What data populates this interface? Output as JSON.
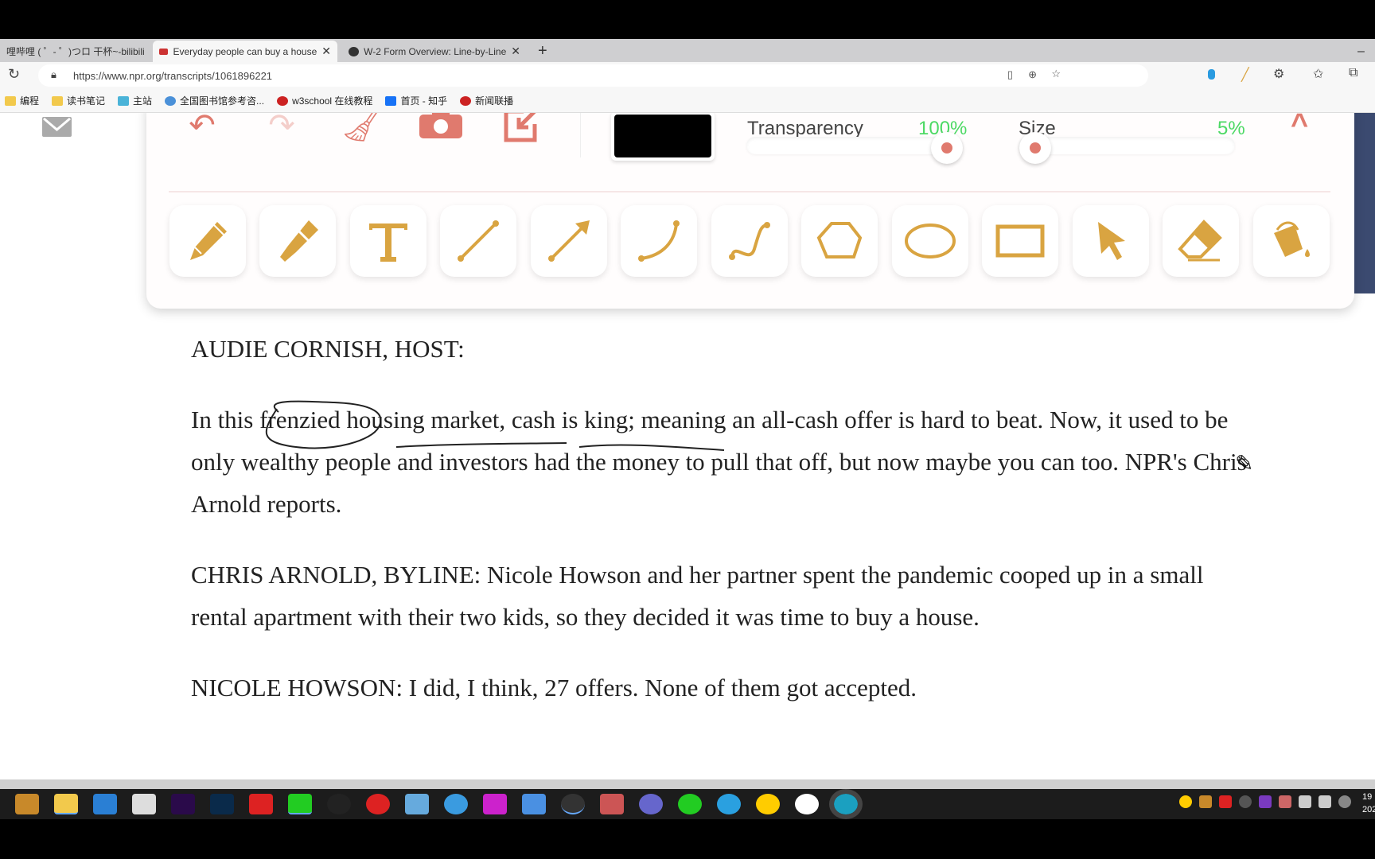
{
  "browser": {
    "tabs": [
      {
        "title": "哩哔哩 ( ゜- ゜)つロ 干杯~-bilibili",
        "active": false
      },
      {
        "title": "Everyday people can buy a house",
        "active": true
      },
      {
        "title": "W-2 Form Overview: Line-by-Line",
        "active": false
      }
    ],
    "new_tab": "+",
    "url": "https://www.npr.org/transcripts/1061896221",
    "bookmarks": [
      "编程",
      "读书笔记",
      "主站",
      "全国图书馆参考咨...",
      "w3school 在线教程",
      "首页 - 知乎",
      "新闻联播"
    ]
  },
  "toolbar": {
    "top_icons": [
      "undo-icon",
      "redo-icon",
      "clear-broom-icon",
      "camera-icon",
      "export-icon"
    ],
    "color": "#000000",
    "transparency_label": "Transparency",
    "transparency_value": "100%",
    "transparency": 100,
    "size_label": "Size",
    "size_value": "5%",
    "size": 5,
    "tools": [
      "pencil",
      "marker",
      "text",
      "line",
      "arrow",
      "curve",
      "s-curve",
      "polygon",
      "ellipse",
      "rectangle",
      "pointer",
      "eraser",
      "fill-bucket"
    ],
    "accent": "#d9a441",
    "danger": "#e07a6e",
    "value_color": "#4cd964"
  },
  "transcript": [
    "AUDIE CORNISH, HOST:",
    "In this frenzied housing market, cash is king; meaning an all-cash offer is hard to beat. Now, it used to be only wealthy people and investors had the money to pull that off, but now maybe you can too. NPR's Chris Arnold reports.",
    "CHRIS ARNOLD, BYLINE: Nicole Howson and her partner spent the pandemic cooped up in a small rental apartment with their two kids, so they decided it was time to buy a house.",
    "NICOLE HOWSON: I did, I think, 27 offers. None of them got accepted."
  ],
  "taskbar": {
    "clock_partial": [
      "19",
      "202"
    ]
  }
}
